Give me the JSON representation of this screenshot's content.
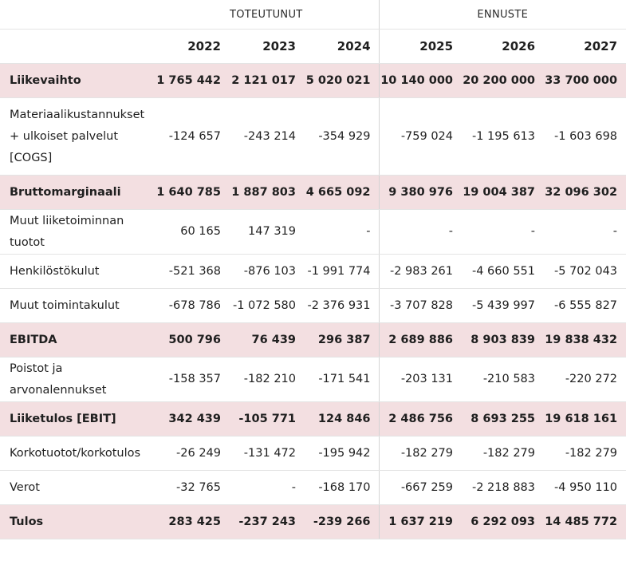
{
  "header": {
    "group_actual": "TOTEUTUNUT",
    "group_forecast": "ENNUSTE",
    "years": [
      "2022",
      "2023",
      "2024",
      "2025",
      "2026",
      "2027"
    ]
  },
  "rows": [
    {
      "label": "Liikevaihto",
      "highlight": true,
      "values": [
        "1 765 442",
        "2 121 017",
        "5 020 021",
        "10 140 000",
        "20 200 000",
        "33 700 000"
      ]
    },
    {
      "label": "Materiaalikustannukset + ulkoiset palvelut [COGS]",
      "highlight": false,
      "values": [
        "-124 657",
        "-243 214",
        "-354 929",
        "-759 024",
        "-1 195 613",
        "-1 603 698"
      ]
    },
    {
      "label": "Bruttomarginaali",
      "highlight": true,
      "values": [
        "1 640 785",
        "1 887 803",
        "4 665 092",
        "9 380 976",
        "19 004 387",
        "32 096 302"
      ]
    },
    {
      "label": "Muut liiketoiminnan tuotot",
      "highlight": false,
      "values": [
        "60 165",
        "147 319",
        "-",
        "-",
        "-",
        "-"
      ]
    },
    {
      "label": "Henkilöstökulut",
      "highlight": false,
      "values": [
        "-521 368",
        "-876 103",
        "-1 991 774",
        "-2 983 261",
        "-4 660 551",
        "-5 702 043"
      ]
    },
    {
      "label": "Muut toimintakulut",
      "highlight": false,
      "values": [
        "-678 786",
        "-1 072 580",
        "-2 376 931",
        "-3 707 828",
        "-5 439 997",
        "-6 555 827"
      ]
    },
    {
      "label": "EBITDA",
      "highlight": true,
      "values": [
        "500 796",
        "76 439",
        "296 387",
        "2 689 886",
        "8 903 839",
        "19 838 432"
      ]
    },
    {
      "label": "Poistot ja arvonalennukset",
      "highlight": false,
      "values": [
        "-158 357",
        "-182 210",
        "-171 541",
        "-203 131",
        "-210 583",
        "-220 272"
      ]
    },
    {
      "label": "Liiketulos [EBIT]",
      "highlight": true,
      "values": [
        "342 439",
        "-105 771",
        "124 846",
        "2 486 756",
        "8 693 255",
        "19 618 161"
      ]
    },
    {
      "label": "Korkotuotot/korkotulos",
      "highlight": false,
      "values": [
        "-26 249",
        "-131 472",
        "-195 942",
        "-182 279",
        "-182 279",
        "-182 279"
      ]
    },
    {
      "label": "Verot",
      "highlight": false,
      "values": [
        "-32 765",
        "-",
        "-168 170",
        "-667 259",
        "-2 218 883",
        "-4 950 110"
      ]
    },
    {
      "label": "Tulos",
      "highlight": true,
      "values": [
        "283 425",
        "-237 243",
        "-239 266",
        "1 637 219",
        "6 292 093",
        "14 485 772"
      ]
    }
  ],
  "colors": {
    "highlight_row": "#f3dfe1",
    "row_border": "#e4e4e4",
    "separator": "#d4d4d4"
  }
}
